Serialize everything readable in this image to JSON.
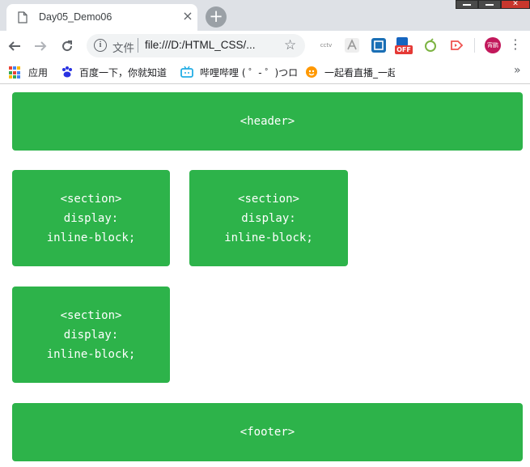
{
  "browser": {
    "tab_title": "Day05_Demo06",
    "tab_close": "×",
    "new_tab": "+",
    "scheme_label": "文件",
    "url": "file:///D:/HTML_CSS/...",
    "avatar_text": "宵鹏",
    "ext_off_badge": "OFF",
    "ext_cctv": "cctv"
  },
  "bookmarks": [
    {
      "label": "应用"
    },
    {
      "label": "百度一下，你就知道"
    },
    {
      "label": "哔哩哔哩 ( ゜- ゜)つロ"
    },
    {
      "label": "一起看直播_一起看精"
    }
  ],
  "page": {
    "header": "<header>",
    "footer": "<footer>",
    "sections": [
      {
        "tag": "<section>",
        "line2": "display:",
        "line3": "inline-block;"
      },
      {
        "tag": "<section>",
        "line2": "display:",
        "line3": "inline-block;"
      },
      {
        "tag": "<section>",
        "line2": "display:",
        "line3": "inline-block;"
      }
    ]
  },
  "colors": {
    "box_green": "#2db34a",
    "chrome_frame": "#dee1e6"
  }
}
